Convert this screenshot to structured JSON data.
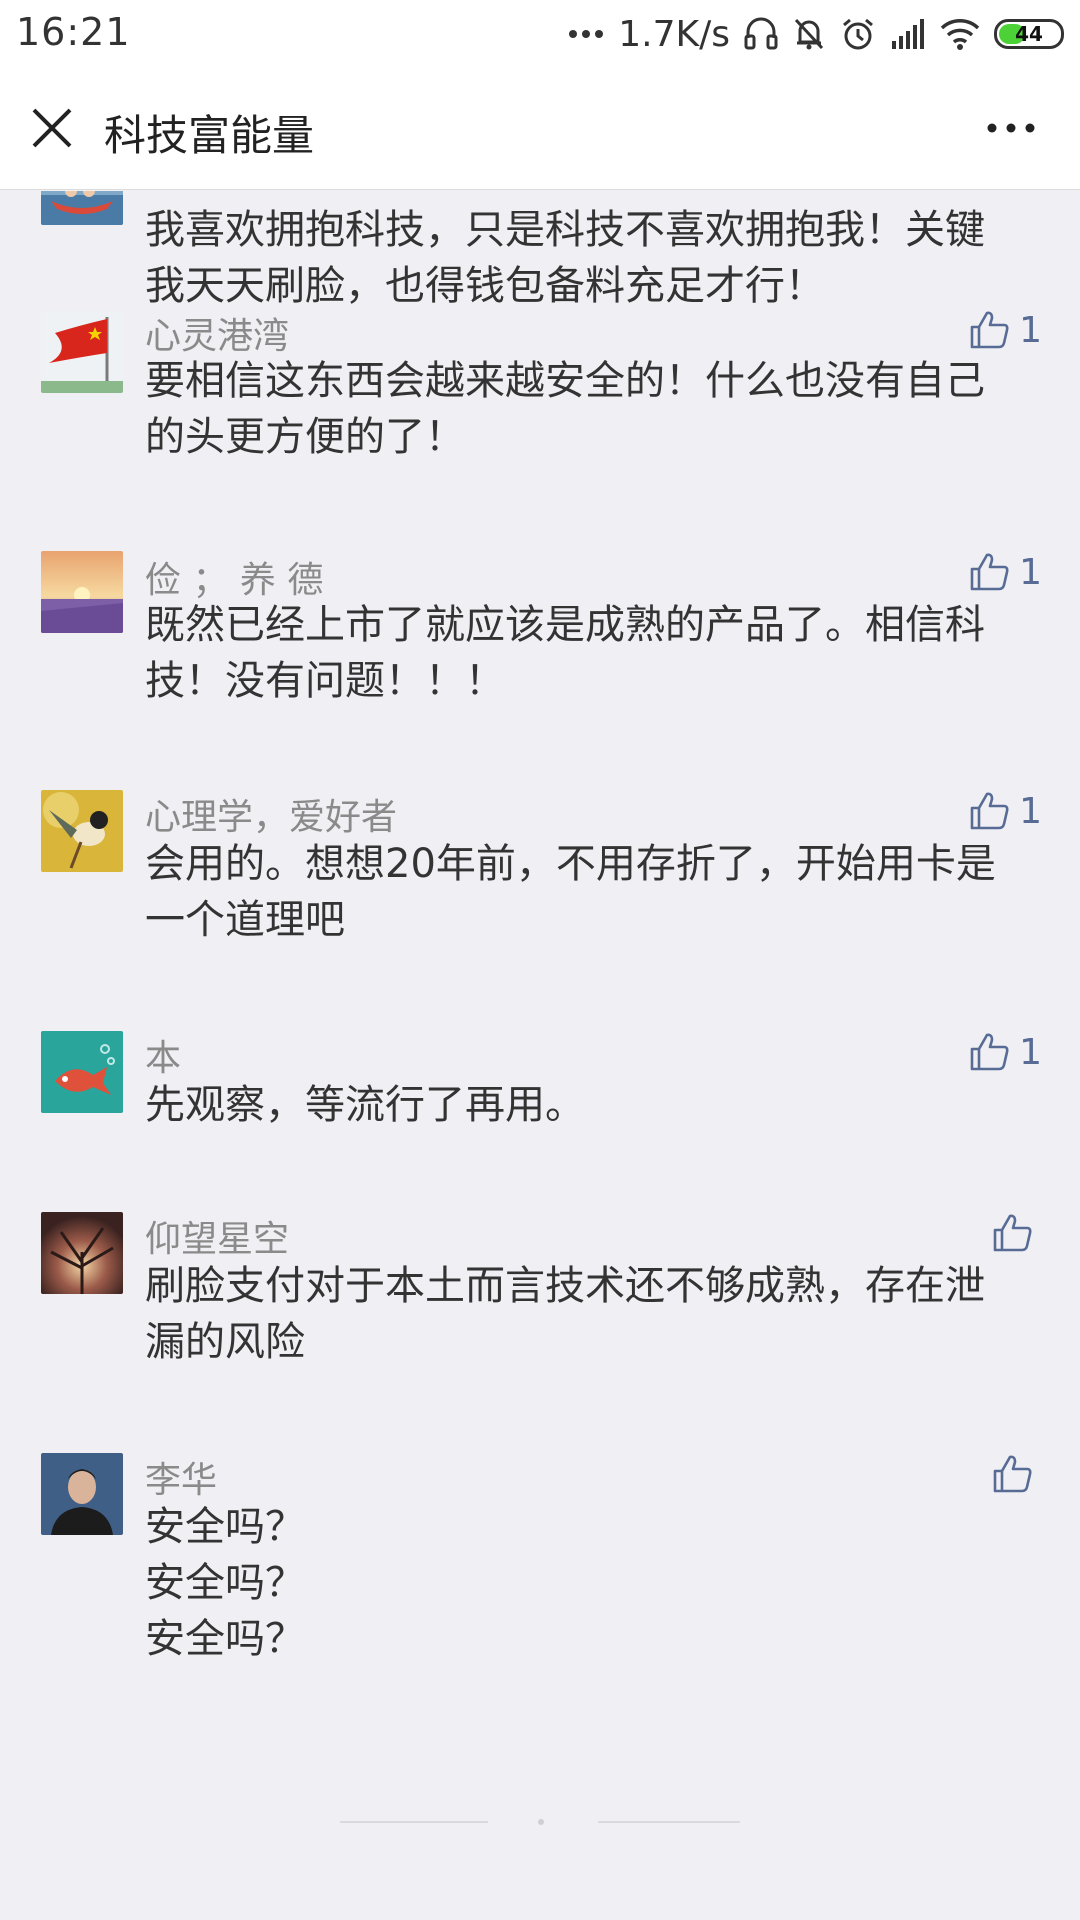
{
  "status_bar": {
    "time": "16:21",
    "network_speed": "1.7K/s",
    "battery_level": "44",
    "battery_percent": 44,
    "icons": [
      "more-dots-icon",
      "headset-icon",
      "mute-bell-icon",
      "alarm-icon",
      "signal-icon",
      "wifi-icon",
      "battery-icon"
    ]
  },
  "nav": {
    "title": "科技富能量",
    "close_icon": "close-icon",
    "more_icon": "more-icon"
  },
  "colors": {
    "accent": "#576b95",
    "background": "#efeff4",
    "name_text": "#8a8a8a",
    "body_text": "#333333",
    "battery": "#4cd137"
  },
  "comments": [
    {
      "name": "",
      "text": "我喜欢拥抱科技，只是科技不喜欢拥抱我！关键\n我天天刷脸，也得钱包备料充足才行！",
      "likes": "",
      "avatar": "boat-photo-avatar"
    },
    {
      "name": "心灵港湾",
      "text": "要相信这东西会越来越安全的！什么也没有自己\n的头更方便的了！",
      "likes": "1",
      "avatar": "flag-photo-avatar"
    },
    {
      "name": "俭 ； 养 德",
      "text": "既然已经上市了就应该是成熟的产品了。相信科\n技！没有问题！！！",
      "likes": "1",
      "avatar": "lavender-sunset-avatar"
    },
    {
      "name": "心理学，爱好者",
      "text": "会用的。想想20年前，不用存折了，开始用卡是\n一个道理吧",
      "likes": "1",
      "avatar": "bird-photo-avatar"
    },
    {
      "name": "本",
      "text": "先观察，等流行了再用。",
      "likes": "1",
      "avatar": "fish-illustration-avatar"
    },
    {
      "name": "仰望星空",
      "text": "刷脸支付对于本土而言技术还不够成熟，存在泄\n漏的风险",
      "likes": "",
      "avatar": "tree-sunset-avatar"
    },
    {
      "name": "李华",
      "text": "安全吗？\n安全吗？\n安全吗？",
      "likes": "",
      "avatar": "portrait-avatar"
    }
  ]
}
